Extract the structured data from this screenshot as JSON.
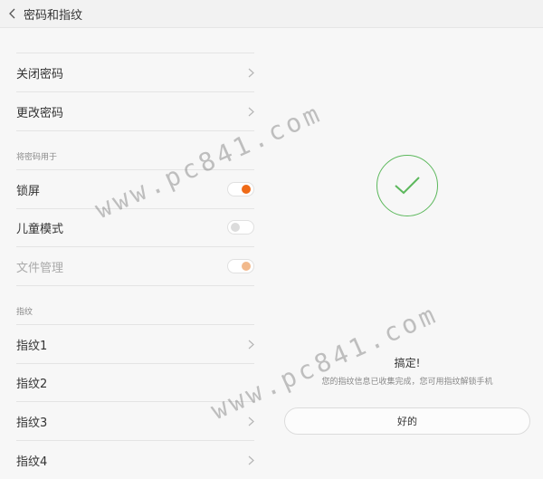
{
  "header": {
    "title": "密码和指纹",
    "back_icon": "chevron-left-icon"
  },
  "password_rows": [
    {
      "label": "关闭密码"
    },
    {
      "label": "更改密码"
    }
  ],
  "use_password_for": {
    "section_title": "将密码用于",
    "items": [
      {
        "label": "锁屏",
        "enabled": true
      },
      {
        "label": "儿童模式",
        "enabled": false
      },
      {
        "label": "文件管理",
        "enabled": true,
        "disabled": true
      }
    ]
  },
  "fingerprint": {
    "section_title": "指纹",
    "items": [
      {
        "label": "指纹1"
      },
      {
        "label": "指纹2"
      },
      {
        "label": "指纹3"
      },
      {
        "label": "指纹4"
      }
    ]
  },
  "result_panel": {
    "icon": "checkmark-icon",
    "title": "搞定!",
    "message": "您的指纹信息已收集完成，您可用指纹解锁手机",
    "button_label": "好的"
  },
  "watermarks": [
    "www.pc841.com",
    "www.pc841.com"
  ],
  "colors": {
    "accent": "#ef6a17",
    "accent_disabled": "#f2b98c",
    "toggle_off_knob": "#dcdcdc",
    "success": "#5cb85c"
  }
}
